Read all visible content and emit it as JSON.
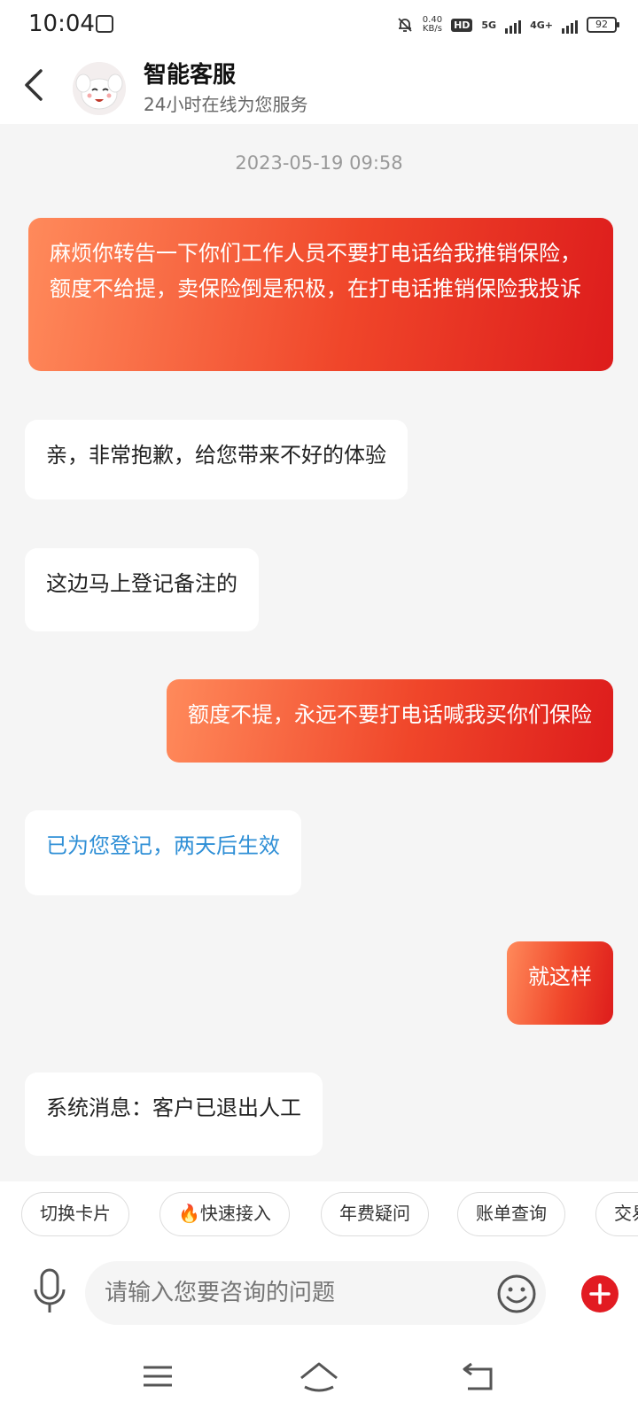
{
  "status_bar": {
    "time": "10:04",
    "net_speed_value": "0.40",
    "net_speed_unit": "KB/s",
    "hd_label": "HD",
    "sim1_network": "5G",
    "sim2_network": "4G+",
    "battery": "92"
  },
  "header": {
    "title": "智能客服",
    "subtitle": "24小时在线为您服务"
  },
  "chat": {
    "timestamp": "2023-05-19 09:58",
    "messages": [
      {
        "from": "user",
        "text": "麻烦你转告一下你们工作人员不要打电话给我推销保险，额度不给提，卖保险倒是积极，在打电话推销保险我投诉"
      },
      {
        "from": "agent",
        "text": "亲，非常抱歉，给您带来不好的体验"
      },
      {
        "from": "agent",
        "text": "这边马上登记备注的"
      },
      {
        "from": "user",
        "text": "额度不提，永远不要打电话喊我买你们保险"
      },
      {
        "from": "agent",
        "text": "已为您登记，两天后生效"
      },
      {
        "from": "user",
        "text": "就这样"
      },
      {
        "from": "agent",
        "text": "系统消息：客户已退出人工"
      }
    ]
  },
  "quick_actions": [
    {
      "label": "切换卡片"
    },
    {
      "label": "🔥快速接入"
    },
    {
      "label": "年费疑问"
    },
    {
      "label": "账单查询"
    },
    {
      "label": "交易"
    }
  ],
  "input": {
    "placeholder": "请输入您要咨询的问题"
  },
  "icons": {
    "back": "chevron-left-icon",
    "mic": "microphone-icon",
    "emoji": "smiley-icon",
    "plus": "plus-icon",
    "nav_menu": "menu-icon",
    "nav_home": "home-icon",
    "nav_back": "return-icon"
  },
  "colors": {
    "user_bubble_start": "#ff8a5b",
    "user_bubble_end": "#dd1c1c",
    "agent_link_text": "#2f8fd6",
    "plus_button": "#e21b22"
  }
}
